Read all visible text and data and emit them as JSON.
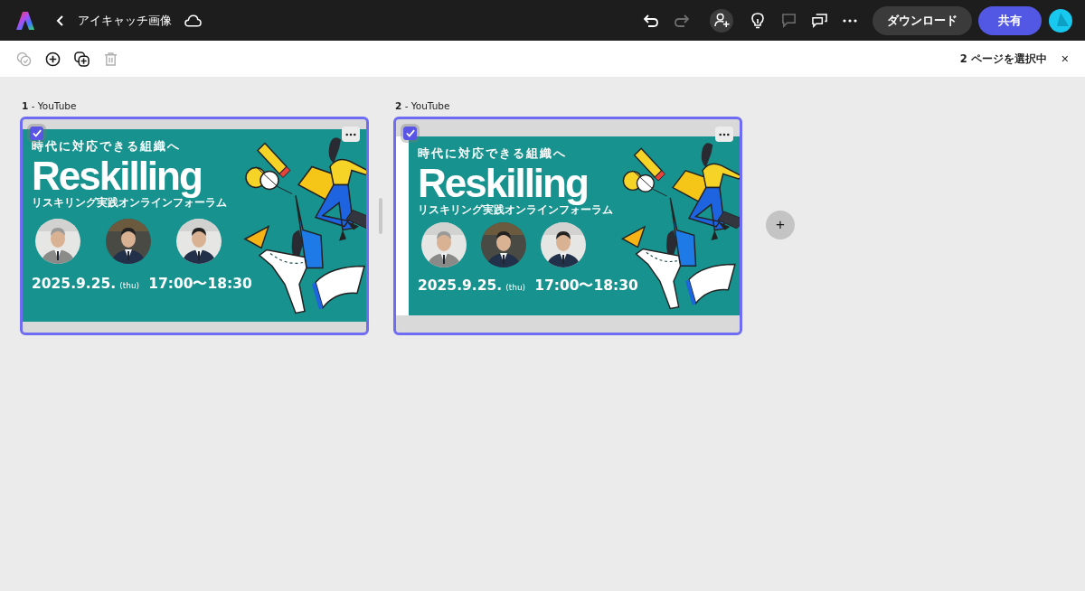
{
  "app_bar": {
    "title": "アイキャッチ画像",
    "tools": [
      {
        "kind": "undo",
        "disabled": false
      },
      {
        "kind": "redo",
        "disabled": true
      },
      {
        "kind": "invite",
        "disabled": false
      },
      {
        "kind": "bulb",
        "disabled": false
      },
      {
        "kind": "comment",
        "disabled": true
      },
      {
        "kind": "chat",
        "disabled": false
      },
      {
        "kind": "more",
        "disabled": false
      }
    ],
    "download": "ダウンロード",
    "share": "共有"
  },
  "page_toolbar": {
    "tools": [
      {
        "kind": "select-all",
        "disabled": true
      },
      {
        "kind": "add",
        "disabled": false
      },
      {
        "kind": "duplicate",
        "disabled": false
      },
      {
        "kind": "delete",
        "disabled": true
      }
    ],
    "selection": "2 ページを選択中",
    "close": "×"
  },
  "pages": [
    {
      "label": "**1** - YouTube",
      "selected": true,
      "kind": "full",
      "poster": {
        "heading": "時代に対応できる組織へ",
        "title": "Reskilling",
        "subtitle": "リスキリング実践オンラインフォーラム",
        "date": "2025.9.25.",
        "day": "(thu)",
        "time": "17:00〜18:30"
      }
    },
    {
      "label": "**2** - YouTube",
      "selected": true,
      "kind": "inset",
      "poster": {
        "heading": "時代に対応できる組織へ",
        "title": "Reskilling",
        "subtitle": "リスキリング実践オンラインフォーラム",
        "date": "2025.9.25.",
        "day": "(thu)",
        "time": "17:00〜18:30"
      }
    }
  ],
  "add_page": "+"
}
